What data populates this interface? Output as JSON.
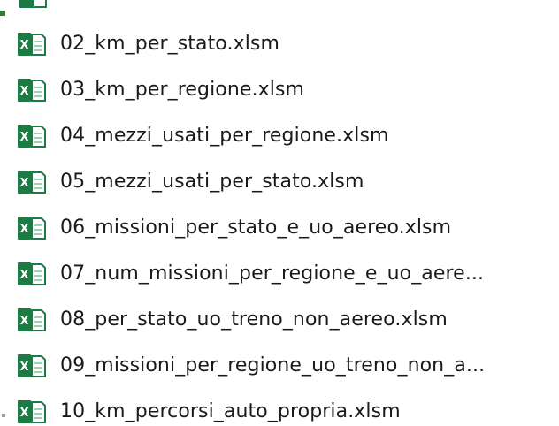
{
  "colors": {
    "excel_green": "#1d7a45",
    "excel_light": "#9ad3ae",
    "text": "#1a1a1a",
    "background": "#ffffff"
  },
  "icon_name": "excel-file-icon",
  "files": [
    {
      "name": "02_km_per_stato.xlsm"
    },
    {
      "name": "03_km_per_regione.xlsm"
    },
    {
      "name": "04_mezzi_usati_per_regione.xlsm"
    },
    {
      "name": "05_mezzi_usati_per_stato.xlsm"
    },
    {
      "name": "06_missioni_per_stato_e_uo_aereo.xlsm"
    },
    {
      "name": "07_num_missioni_per_regione_e_uo_aere..."
    },
    {
      "name": "08_per_stato_uo_treno_non_aereo.xlsm"
    },
    {
      "name": "09_missioni_per_regione_uo_treno_non_a..."
    },
    {
      "name": "10_km_percorsi_auto_propria.xlsm"
    }
  ]
}
